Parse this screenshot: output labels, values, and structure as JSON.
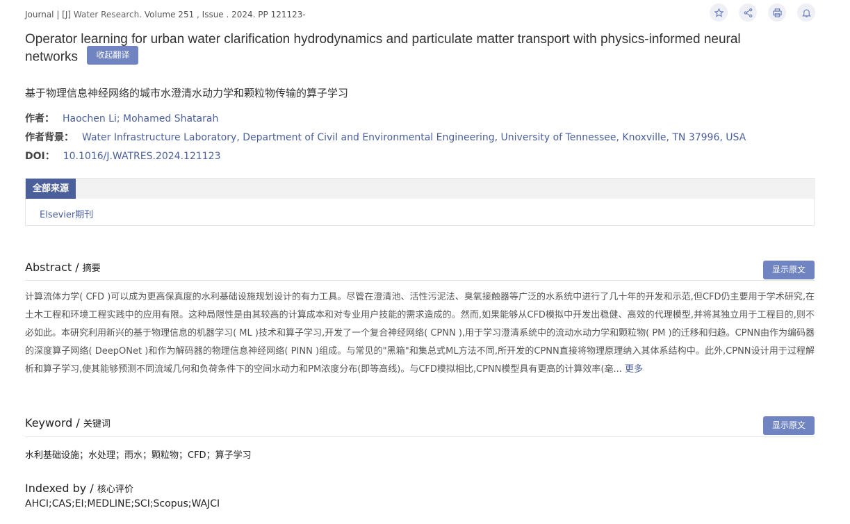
{
  "header": {
    "journal_line": "Journal | [J] ",
    "journal_name": "Water Research",
    "volume_line": ". Volume 251 , Issue . 2024. PP 121123-"
  },
  "icons": [
    "star-icon",
    "share-icon",
    "print-icon",
    "bell-icon"
  ],
  "title": "Operator learning for urban water clarification hydrodynamics and particulate matter transport with physics-informed neural networks",
  "collapse_translation_label": "收起翻译",
  "chinese_title": "基于物理信息神经网络的城市水澄清水动力学和颗粒物传输的算子学习",
  "meta": {
    "authors_label": "作者：",
    "authors": "Haochen Li; Mohamed Shatarah",
    "affiliation_label": "作者背景：",
    "affiliation": "Water Infrastructure Laboratory, Department of Civil and Environmental Engineering, University of Tennessee, Knoxville, TN 37996, USA",
    "doi_label": "DOI：",
    "doi": "10.1016/J.WATRES.2024.121123"
  },
  "sources": {
    "tab_label": "全部来源",
    "items": [
      "Elsevier期刊"
    ]
  },
  "abstract": {
    "heading": "Abstract / ",
    "heading_cn": "摘要",
    "show_original_label": "显示原文",
    "text": "计算流体力学( CFD )可以成为更高保真度的水利基础设施规划设计的有力工具。尽管在澄清池、活性污泥法、臭氧接触器等广泛的水系统中进行了几十年的开发和示范,但CFD仍主要用于学术研究,在土木工程和环境工程实践中的应用有限。这种局限性是由其较高的计算成本和对专业用户技能的需求造成的。然而,如果能够从CFD模拟中开发出稳健、高效的代理模型,并将其独立用于工程目的,则不必如此。本研究利用新兴的基于物理信息的机器学习( ML )技术和算子学习,开发了一个复合神经网络( CPNN ),用于学习澄清系统中的流动水动力学和颗粒物( PM )的迁移和归趋。CPNN由作为编码器的深度算子网络( DeepONet )和作为解码器的物理信息神经网络( PINN )组成。与常见的\"黑箱\"和集总式ML方法不同,所开发的CPNN直接将物理原理纳入其体系结构中。此外,CPNN设计用于过程解析和算子学习,使其能够预测不同流域几何和负荷条件下的空间水动力和PM浓度分布(即等高线)。与CFD模拟相比,CPNN模型具有更高的计算效率(毫...",
    "more_label": "更多"
  },
  "keyword": {
    "heading": "Keyword / ",
    "heading_cn": "关键词",
    "show_original_label": "显示原文",
    "text": "水利基础设施；水处理；雨水；颗粒物；CFD；算子学习"
  },
  "indexed": {
    "heading": "Indexed by / ",
    "heading_cn": "核心评价",
    "text": "AHCI;CAS;EI;MEDLINE;SCI;Scopus;WAJCI"
  },
  "colors": {
    "accent": "#4b5f9b",
    "button": "#6f84c1",
    "icon_bg": "#eef0f5"
  }
}
